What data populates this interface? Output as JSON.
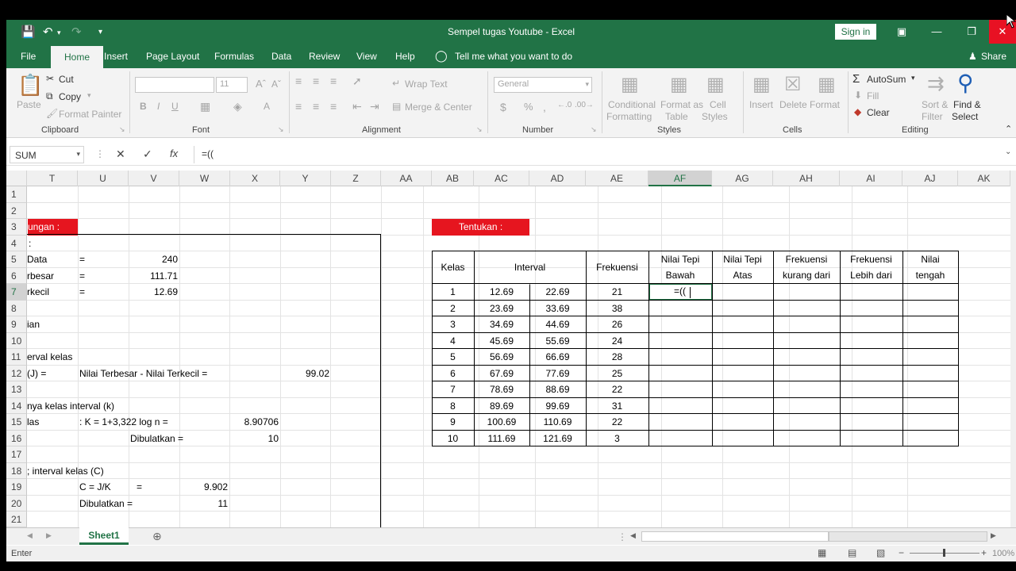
{
  "window": {
    "title": "Sempel tugas Youtube  -  Excel",
    "sign_in": "Sign in"
  },
  "menu": {
    "tabs": [
      "File",
      "Home",
      "Insert",
      "Page Layout",
      "Formulas",
      "Data",
      "Review",
      "View",
      "Help"
    ],
    "tell_me": "Tell me what you want to do",
    "share": "Share"
  },
  "ribbon": {
    "clipboard": {
      "label": "Clipboard",
      "paste": "Paste",
      "cut": "Cut",
      "copy": "Copy",
      "format_painter": "Format Painter"
    },
    "font": {
      "label": "Font",
      "size": "11"
    },
    "alignment": {
      "label": "Alignment",
      "wrap": "Wrap Text",
      "merge": "Merge & Center"
    },
    "number": {
      "label": "Number",
      "format": "General"
    },
    "styles": {
      "label": "Styles",
      "conditional": "Conditional",
      "conditional2": "Formatting",
      "format_as": "Format as",
      "format_as2": "Table",
      "cell_styles": "Cell",
      "cell_styles2": "Styles"
    },
    "cells": {
      "label": "Cells",
      "insert": "Insert",
      "delete": "Delete",
      "format": "Format"
    },
    "editing": {
      "label": "Editing",
      "autosum": "AutoSum",
      "fill": "Fill",
      "clear": "Clear",
      "sort": "Sort &",
      "sort2": "Filter",
      "find": "Find &",
      "find2": "Select"
    }
  },
  "formula_bar": {
    "name_box": "SUM",
    "formula": "=(("
  },
  "columns": [
    "T",
    "U",
    "V",
    "W",
    "X",
    "Y",
    "Z",
    "AA",
    "AB",
    "AC",
    "AD",
    "AE",
    "AF",
    "AG",
    "AH",
    "AI",
    "AJ",
    "AK"
  ],
  "selected_column": "AF",
  "rows": [
    "1",
    "2",
    "3",
    "4",
    "5",
    "6",
    "7",
    "8",
    "9",
    "10",
    "11",
    "12",
    "13",
    "14",
    "15",
    "16",
    "17",
    "18",
    "19",
    "20",
    "21"
  ],
  "left": {
    "header_red": "ungan :",
    "r4": ":",
    "r5_label": "Data",
    "r5_eq": "=",
    "r5_val": "240",
    "r6_label": "rbesar",
    "r6_eq": "=",
    "r6_val": "111.71",
    "r7_label": "rkecil",
    "r7_eq": "=",
    "r7_val": "12.69",
    "r9": "ian",
    "r11": "erval kelas",
    "r12_a": "(J) =",
    "r12_b": "Nilai Terbesar - Nilai Terkecil =",
    "r12_val": "99.02",
    "r14": "nya kelas interval (k)",
    "r15_a": "las",
    "r15_b": ":  K = 1+3,322 log n    =",
    "r15_val": "8.90706",
    "r16_b": "Dibulatkan =",
    "r16_val": "10",
    "r18": "; interval kelas (C)",
    "r19_b": "C = J/K",
    "r19_eq": "=",
    "r19_val": "9.902",
    "r20_b": "Dibulatkan =",
    "r20_val": "11"
  },
  "right": {
    "header_red": "Tentukan :",
    "headers": {
      "kelas": "Kelas",
      "interval": "Interval",
      "frekuensi": "Frekuensi",
      "tepi_bawah": [
        "Nilai Tepi",
        "Bawah"
      ],
      "tepi_atas": [
        "Nilai Tepi",
        "Atas"
      ],
      "kurang": [
        "Frekuensi",
        "kurang dari"
      ],
      "lebih": [
        "Frekuensi",
        "Lebih dari"
      ],
      "tengah": [
        "Nilai",
        "tengah"
      ]
    },
    "rows": [
      [
        "1",
        "12.69",
        "22.69",
        "21"
      ],
      [
        "2",
        "23.69",
        "33.69",
        "38"
      ],
      [
        "3",
        "34.69",
        "44.69",
        "26"
      ],
      [
        "4",
        "45.69",
        "55.69",
        "24"
      ],
      [
        "5",
        "56.69",
        "66.69",
        "28"
      ],
      [
        "6",
        "67.69",
        "77.69",
        "25"
      ],
      [
        "7",
        "78.69",
        "88.69",
        "22"
      ],
      [
        "8",
        "89.69",
        "99.69",
        "31"
      ],
      [
        "9",
        "100.69",
        "110.69",
        "22"
      ],
      [
        "10",
        "111.69",
        "121.69",
        "3"
      ]
    ],
    "editing_cell": "=(("
  },
  "sheet": {
    "tab": "Sheet1"
  },
  "status": {
    "mode": "Enter",
    "zoom": "100%"
  },
  "colors": {
    "excel_green": "#217346",
    "red_fill": "#e6151f",
    "close_red": "#e81123"
  }
}
